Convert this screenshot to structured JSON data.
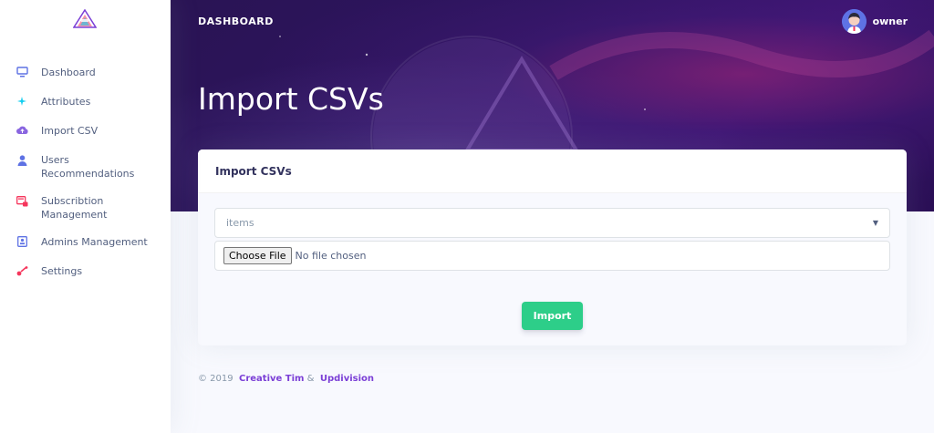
{
  "colors": {
    "accent": "#5e72e4",
    "success": "#2dce89",
    "link": "#7b3fd6",
    "header_bg": "#2d1460"
  },
  "sidebar": {
    "logo_icon": "triangle-logo",
    "items": [
      {
        "label": "Dashboard",
        "icon": "monitor-icon",
        "color": "#5e72e4"
      },
      {
        "label": "Attributes",
        "icon": "sparkle-icon",
        "color": "#11cdef"
      },
      {
        "label": "Import CSV",
        "icon": "cloud-upload-icon",
        "color": "#8965e0"
      },
      {
        "label": "Users Recommendations",
        "icon": "user-icon",
        "color": "#5e72e4"
      },
      {
        "label": "Subscribtion Management",
        "icon": "billing-icon",
        "color": "#f5365c"
      },
      {
        "label": "Admins Management",
        "icon": "admin-icon",
        "color": "#5e72e4"
      },
      {
        "label": "Settings",
        "icon": "settings-icon",
        "color": "#f5365c"
      }
    ]
  },
  "header": {
    "breadcrumb": "DASHBOARD",
    "user_name": "owner",
    "page_title": "Import CSVs"
  },
  "card": {
    "title": "Import CSVs",
    "select_value": "items",
    "file_button": "Choose File",
    "file_status": "No file chosen",
    "import_button": "Import"
  },
  "footer": {
    "copyright": "© 2019",
    "link1": "Creative Tim",
    "separator": "&",
    "link2": "Updivision"
  }
}
